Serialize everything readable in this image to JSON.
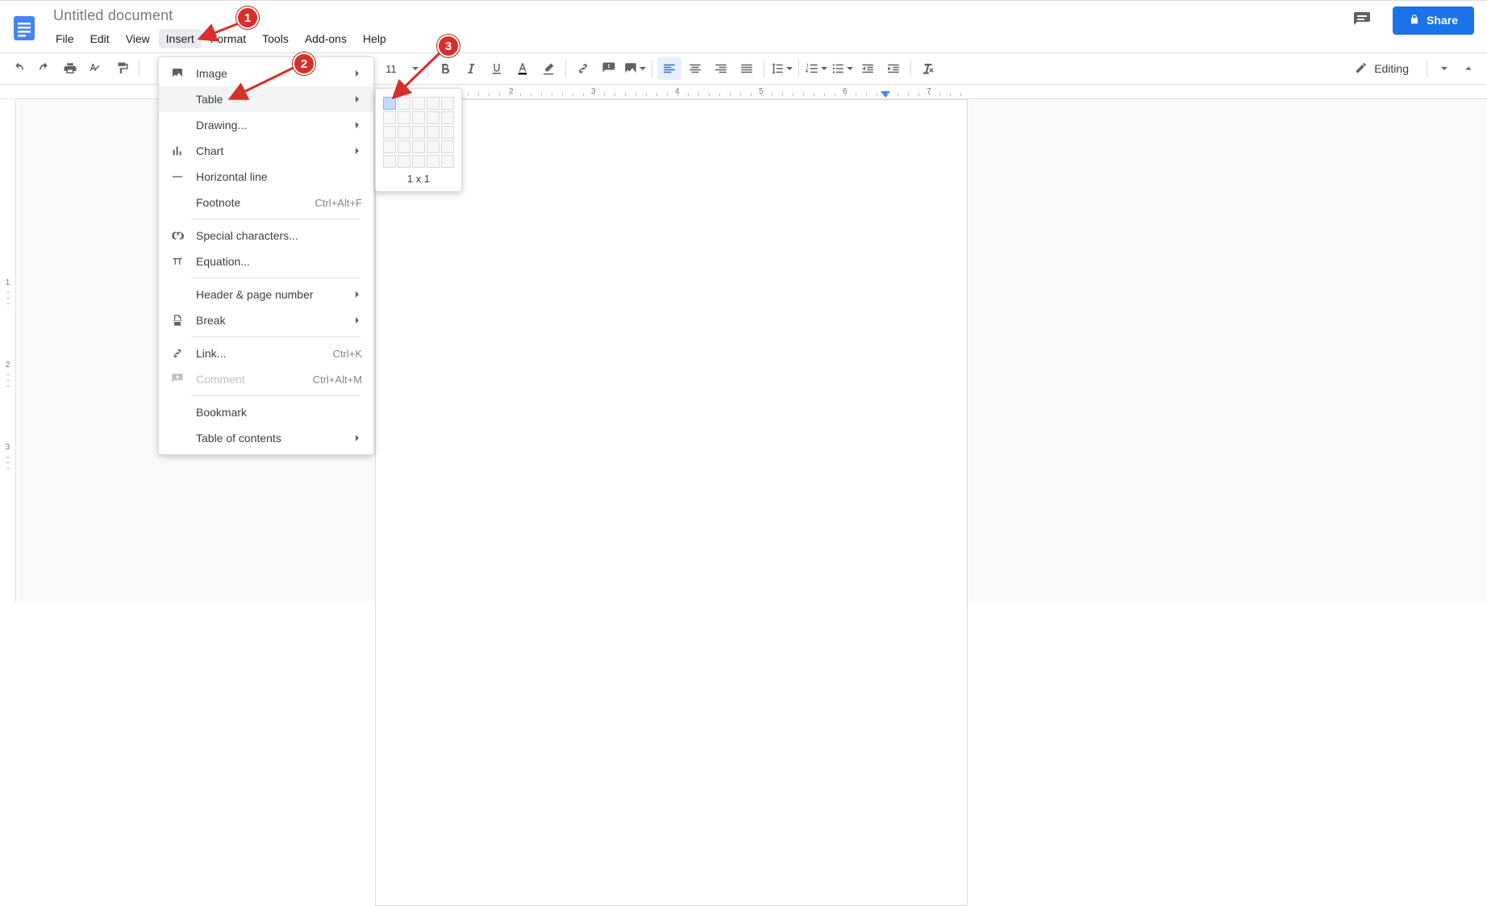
{
  "doc": {
    "title": "Untitled document"
  },
  "menubar": {
    "file": "File",
    "edit": "Edit",
    "view": "View",
    "insert": "Insert",
    "format": "Format",
    "tools": "Tools",
    "addons": "Add-ons",
    "help": "Help"
  },
  "share": {
    "label": "Share"
  },
  "toolbar": {
    "font_size": "11",
    "editing": "Editing"
  },
  "ruler": {
    "h": [
      "2",
      "3",
      "4",
      "5",
      "6",
      "7"
    ]
  },
  "vruler": [
    "1",
    "2",
    "3"
  ],
  "insert_menu": {
    "image": "Image",
    "table": "Table",
    "drawing": "Drawing...",
    "chart": "Chart",
    "hline": "Horizontal line",
    "footnote": "Footnote",
    "footnote_sc": "Ctrl+Alt+F",
    "specialchars": "Special characters...",
    "equation": "Equation...",
    "headerpage": "Header & page number",
    "break": "Break",
    "link": "Link...",
    "link_sc": "Ctrl+K",
    "comment": "Comment",
    "comment_sc": "Ctrl+Alt+M",
    "bookmark": "Bookmark",
    "toc": "Table of contents"
  },
  "table_popup": {
    "size": "1 x 1"
  },
  "annotations": {
    "b1": "1",
    "b2": "2",
    "b3": "3"
  }
}
